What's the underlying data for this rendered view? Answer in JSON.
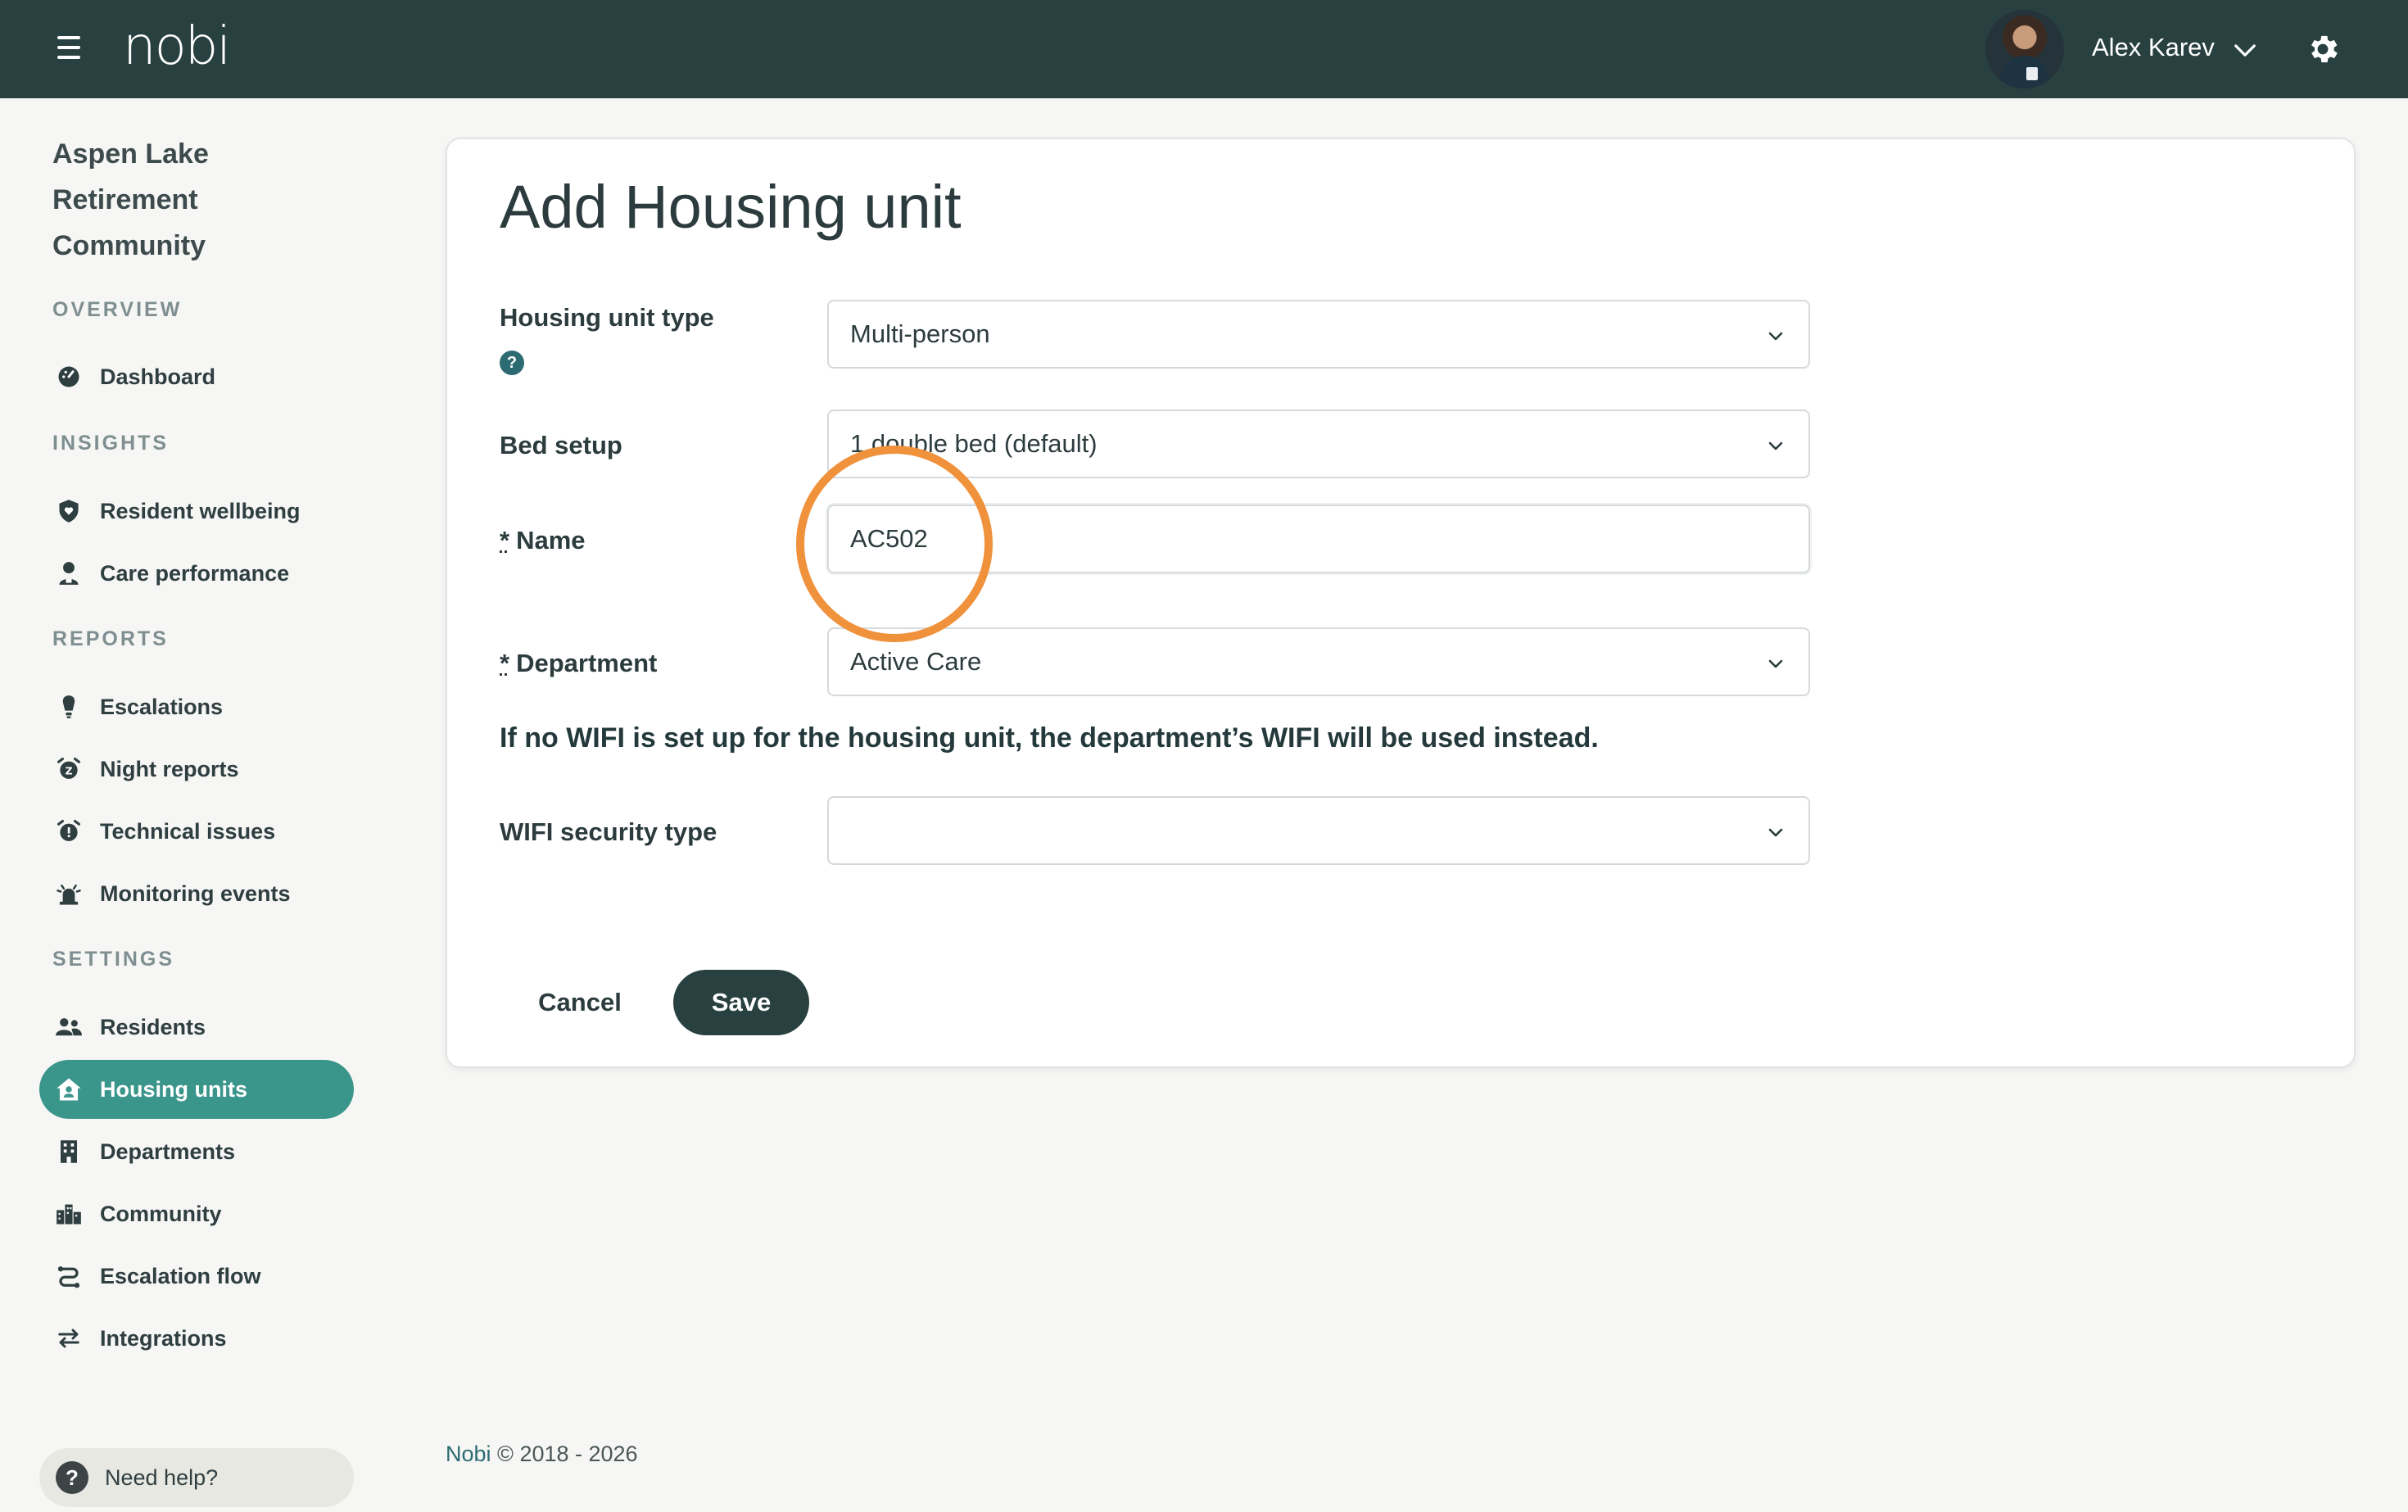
{
  "header": {
    "logo": "nobi",
    "user_name": "Alex Karev"
  },
  "sidebar": {
    "org_name": "Aspen Lake Retirement Community",
    "sections": {
      "overview": "OVERVIEW",
      "insights": "INSIGHTS",
      "reports": "REPORTS",
      "settings": "SETTINGS"
    },
    "items": {
      "dashboard": "Dashboard",
      "resident_wellbeing": "Resident wellbeing",
      "care_performance": "Care performance",
      "escalations": "Escalations",
      "night_reports": "Night reports",
      "technical_issues": "Technical issues",
      "monitoring_events": "Monitoring events",
      "residents": "Residents",
      "housing_units": "Housing units",
      "departments": "Departments",
      "community": "Community",
      "escalation_flow": "Escalation flow",
      "integrations": "Integrations"
    },
    "active_item": "Housing units",
    "help": "Need help?"
  },
  "form": {
    "title": "Add Housing unit",
    "housing_unit_type": {
      "label": "Housing unit type",
      "value": "Multi-person"
    },
    "bed_setup": {
      "label": "Bed setup",
      "value": "1 double bed (default)"
    },
    "name": {
      "required_mark": "*",
      "label": "Name",
      "value": "AC502"
    },
    "department": {
      "required_mark": "*",
      "label": "Department",
      "value": "Active Care"
    },
    "wifi_note": "If no WIFI is set up for the housing unit, the department’s WIFI will be used instead.",
    "wifi_security_type": {
      "label": "WIFI security type",
      "value": ""
    },
    "cancel_label": "Cancel",
    "save_label": "Save"
  },
  "footer": {
    "brand": "Nobi",
    "copyright": "© 2018 - 2026"
  },
  "colors": {
    "topbar": "#28403f",
    "accent": "#3a958b",
    "highlight": "#f0913c"
  }
}
